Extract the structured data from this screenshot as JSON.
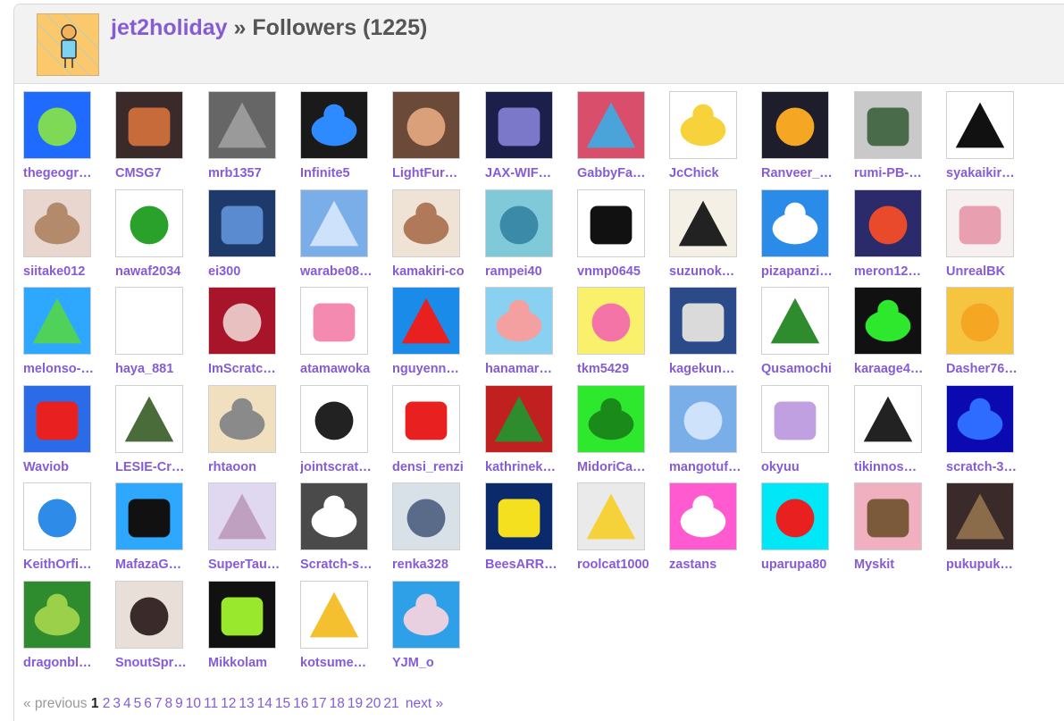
{
  "header": {
    "owner": "jet2holiday",
    "separator": "»",
    "section": "Followers (1225)"
  },
  "accent": "#855cd6",
  "followers": [
    {
      "name": "thegeogr…",
      "icon": "world-map-pixel-avatar"
    },
    {
      "name": "CMSG7",
      "icon": "anime-character-avatar"
    },
    {
      "name": "mrb1357",
      "icon": "default-user-avatar"
    },
    {
      "name": "Infinite5",
      "icon": "blue-robot-avatar"
    },
    {
      "name": "LightFur…",
      "icon": "crowd-photo-avatar"
    },
    {
      "name": "JAX-WIF…",
      "icon": "dark-character-avatar"
    },
    {
      "name": "GabbyFa…",
      "icon": "colorful-scene-avatar"
    },
    {
      "name": "JcChick",
      "icon": "yellow-chick-avatar"
    },
    {
      "name": "Ranveer_…",
      "icon": "code-tag-avatar"
    },
    {
      "name": "rumi-PB-…",
      "icon": "train-avatar"
    },
    {
      "name": "syakaikir…",
      "icon": "apple-logo-avatar"
    },
    {
      "name": "siitake012",
      "icon": "anime-girl-avatar"
    },
    {
      "name": "nawaf2034",
      "icon": "luigi-avatar"
    },
    {
      "name": "ei300",
      "icon": "piano-ei-avatar"
    },
    {
      "name": "warabe08…",
      "icon": "scratch-cat-avatar"
    },
    {
      "name": "kamakiri-co",
      "icon": "hand-photo-avatar"
    },
    {
      "name": "rampei40",
      "icon": "blue-fish-avatar"
    },
    {
      "name": "vnmp0645",
      "icon": "black-cat-avatar"
    },
    {
      "name": "suzunok…",
      "icon": "suzunokena-logo-avatar"
    },
    {
      "name": "pizapanzi…",
      "icon": "pz-cartoon-avatar"
    },
    {
      "name": "meron12…",
      "icon": "looney-tunes-avatar"
    },
    {
      "name": "UnrealBK",
      "icon": "white-cat-avatar"
    },
    {
      "name": "melonso-…",
      "icon": "green-cat-avatar"
    },
    {
      "name": "haya_881",
      "icon": "blank-white-avatar"
    },
    {
      "name": "ImScratc…",
      "icon": "imscratcher-logo-avatar"
    },
    {
      "name": "atamawoka",
      "icon": "pixel-kirby-avatar"
    },
    {
      "name": "nguyenn…",
      "icon": "countryball-avatar"
    },
    {
      "name": "hanamar…",
      "icon": "character-avatar"
    },
    {
      "name": "tkm5429",
      "icon": "kirby-avatar"
    },
    {
      "name": "kagekun…",
      "icon": "blue-cat-avatar"
    },
    {
      "name": "Qusamochi",
      "icon": "qusamochi-logo-avatar"
    },
    {
      "name": "karaage4…",
      "icon": "green-controller-avatar"
    },
    {
      "name": "Dasher76…",
      "icon": "yellow-cat-avatar"
    },
    {
      "name": "Waviob",
      "icon": "red-creature-avatar"
    },
    {
      "name": "LESIE-Cr…",
      "icon": "drawn-person-avatar"
    },
    {
      "name": "rhtaoon",
      "icon": "neko-cats-avatar"
    },
    {
      "name": "jointscrat…",
      "icon": "circle-logo-avatar"
    },
    {
      "name": "densi_renzi",
      "icon": "tomato-avatar"
    },
    {
      "name": "kathrinek…",
      "icon": "christmas-character-avatar"
    },
    {
      "name": "MidoriCa…",
      "icon": "green-midoricat-avatar"
    },
    {
      "name": "mangotuf…",
      "icon": "scratch-cat-avatar"
    },
    {
      "name": "okyuu",
      "icon": "anime-character-avatar"
    },
    {
      "name": "tikinnos…",
      "icon": "white-cube-bird-avatar"
    },
    {
      "name": "scratch-3…",
      "icon": "s-logo-avatar"
    },
    {
      "name": "KeithOrfi…",
      "icon": "sketch-avatar"
    },
    {
      "name": "MafazaG…",
      "icon": "mgs-logo-avatar"
    },
    {
      "name": "SuperTau…",
      "icon": "anime-girl-avatar"
    },
    {
      "name": "Scratch-s…",
      "icon": "s-3d-logo-avatar"
    },
    {
      "name": "renka328",
      "icon": "anime-girl-avatar"
    },
    {
      "name": "BeesARR…",
      "icon": "lightning-bee-avatar"
    },
    {
      "name": "roolcat1000",
      "icon": "sketch-cat-avatar"
    },
    {
      "name": "zastans",
      "icon": "scratch-cat-pink-avatar"
    },
    {
      "name": "uparupa80",
      "icon": "red-face-avatar"
    },
    {
      "name": "Myskit",
      "icon": "pixel-person-avatar"
    },
    {
      "name": "pukupuk…",
      "icon": "dark-scene-avatar"
    },
    {
      "name": "dragonbl…",
      "icon": "green-blob-avatar"
    },
    {
      "name": "SnoutSpr…",
      "icon": "drawn-character-avatar"
    },
    {
      "name": "Mikkolam",
      "icon": "melonships-logo-avatar"
    },
    {
      "name": "kotsume…",
      "icon": "crown-face-avatar"
    },
    {
      "name": "YJM_o",
      "icon": "anime-girl-blue-avatar"
    }
  ],
  "pagination": {
    "previous": "« previous",
    "current": "1",
    "pages": [
      "2",
      "3",
      "4",
      "5",
      "6",
      "7",
      "8",
      "9",
      "10",
      "11",
      "12",
      "13",
      "14",
      "15",
      "16",
      "17",
      "18",
      "19",
      "20",
      "21"
    ],
    "next": "next »"
  }
}
